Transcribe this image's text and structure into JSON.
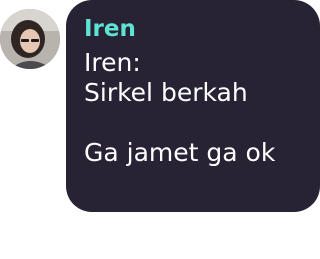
{
  "message": {
    "sender_name": "Iren",
    "sender_color": "#5fe3d4",
    "bubble_color": "#272334",
    "avatar_icon": "user-photo-avatar",
    "text": "Iren:\nSirkel berkah\n\nGa jamet ga ok"
  }
}
